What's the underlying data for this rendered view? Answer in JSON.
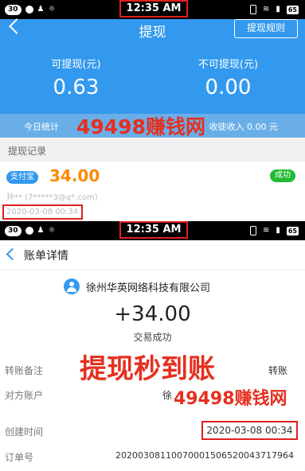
{
  "status_bar": {
    "notif_count": "30",
    "time": "12:35 AM",
    "battery": "65"
  },
  "header": {
    "title": "提现",
    "rules_button": "提现规则"
  },
  "balances": {
    "available_label": "可提现(元)",
    "available_value": "0.63",
    "unavailable_label": "不可提现(元)",
    "unavailable_value": "0.00"
  },
  "stats": {
    "today_label": "今日统计",
    "income_text": "收徒收入 0.00 元"
  },
  "watermark": {
    "site": "49498赚钱网",
    "slogan": "提现秒到账"
  },
  "records": {
    "heading": "提现记录",
    "items": [
      {
        "channel": "支付宝",
        "amount": "34.00",
        "status": "成功",
        "account": "孙** (7*****3@q*.com)",
        "time": "2020-03-08 00:34"
      }
    ]
  },
  "bill_detail": {
    "title": "账单详情",
    "company": "徐州华英网络科技有限公司",
    "amount": "+34.00",
    "status": "交易成功",
    "rows": [
      {
        "label": "转账备注",
        "value": "转账"
      },
      {
        "label": "对方账户",
        "value": "徐"
      },
      {
        "label": "创建时间",
        "value": "2020-03-08 00:34"
      },
      {
        "label": "订单号",
        "value": "20200308110070001506520043717964"
      }
    ]
  },
  "colors": {
    "brand_blue": "#3399ee",
    "watermark_red": "#e53020",
    "amount_orange": "#ff8800",
    "success_green": "#22bb33"
  }
}
